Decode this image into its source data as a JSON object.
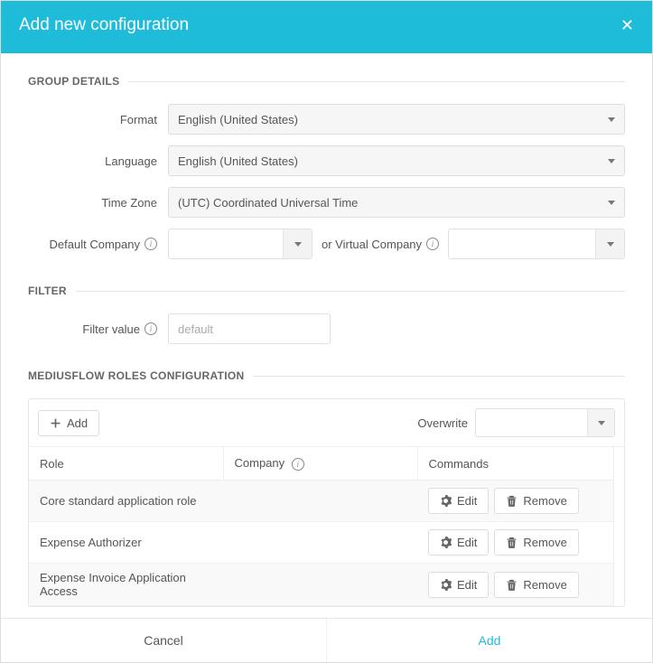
{
  "header": {
    "title": "Add new configuration"
  },
  "sections": {
    "group_details": "GROUP DETAILS",
    "filter": "FILTER",
    "roles": "MEDIUSFLOW ROLES CONFIGURATION"
  },
  "labels": {
    "format": "Format",
    "language": "Language",
    "timezone": "Time Zone",
    "default_company": "Default Company",
    "or_virtual": "or Virtual Company",
    "filter_value": "Filter value",
    "overwrite": "Overwrite"
  },
  "values": {
    "format": "English (United States)",
    "language": "English (United States)",
    "timezone": "(UTC) Coordinated Universal Time",
    "default_company": "",
    "virtual_company": "",
    "filter_placeholder": "default",
    "overwrite": ""
  },
  "buttons": {
    "add_row": "Add",
    "edit": "Edit",
    "remove": "Remove",
    "cancel": "Cancel",
    "add": "Add"
  },
  "table": {
    "headers": {
      "role": "Role",
      "company": "Company",
      "commands": "Commands"
    },
    "rows": [
      {
        "role": "Core standard application role",
        "company": ""
      },
      {
        "role": "Expense Authorizer",
        "company": ""
      },
      {
        "role": "Expense Invoice Application Access",
        "company": ""
      }
    ]
  }
}
